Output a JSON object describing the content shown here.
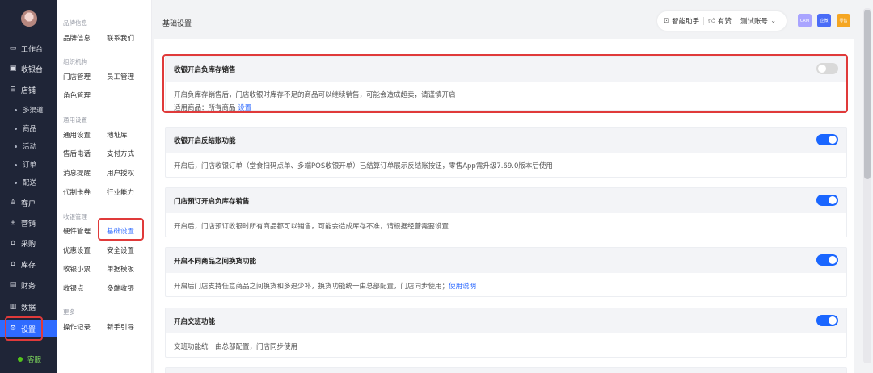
{
  "sidebar": {
    "items": [
      {
        "key": "workbench",
        "label": "工作台",
        "icon": "monitor-icon"
      },
      {
        "key": "pos",
        "label": "收银台",
        "icon": "cashier-icon"
      },
      {
        "key": "store",
        "label": "店铺",
        "icon": "store-icon"
      },
      {
        "key": "customer",
        "label": "客户",
        "icon": "user-icon"
      },
      {
        "key": "marketing",
        "label": "营销",
        "icon": "gift-icon"
      },
      {
        "key": "purchase",
        "label": "采购",
        "icon": "purchase-icon"
      },
      {
        "key": "inventory",
        "label": "库存",
        "icon": "inventory-icon"
      },
      {
        "key": "finance",
        "label": "财务",
        "icon": "finance-icon"
      },
      {
        "key": "data",
        "label": "数据",
        "icon": "bar-chart-icon"
      },
      {
        "key": "settings",
        "label": "设置",
        "icon": "settings-icon"
      }
    ],
    "store_subitems": [
      "多渠道",
      "商品",
      "活动",
      "订单",
      "配送"
    ],
    "support_label": "客服"
  },
  "submenu": {
    "groups": [
      {
        "title": "品牌信息",
        "links": [
          "品牌信息",
          "联系我们"
        ]
      },
      {
        "title": "组织机构",
        "links": [
          "门店管理",
          "员工管理",
          "角色管理"
        ]
      },
      {
        "title": "通用设置",
        "links": [
          "通用设置",
          "地址库",
          "售后电话",
          "支付方式",
          "消息提醒",
          "用户授权",
          "代制卡券",
          "行业能力"
        ]
      },
      {
        "title": "收银管理",
        "links": [
          "硬件管理",
          "基础设置",
          "优惠设置",
          "安全设置",
          "收银小票",
          "单据模板",
          "收银点",
          "多端收银"
        ]
      },
      {
        "title": "更多",
        "links": [
          "操作记录",
          "新手引导"
        ]
      }
    ],
    "active": "基础设置"
  },
  "header": {
    "title": "基础设置",
    "assistant_label": "智能助手",
    "like_label": "有赞",
    "account_label": "测试账号",
    "app_badges": [
      "CRM",
      "企微",
      "零售"
    ],
    "app_badge_colors": [
      "#a9a4ff",
      "#4a6cf7",
      "#f5a623"
    ]
  },
  "settings": [
    {
      "title": "收银开启负库存销售",
      "enabled": false,
      "desc": "开启负库存销售后，门店收银时库存不足的商品可以继续销售，可能会造成超卖，请谨慎开启",
      "extra_prefix": "适用商品：所有商品",
      "extra_link": "设置"
    },
    {
      "title": "收银开启反结账功能",
      "enabled": true,
      "desc": "开启后，门店收银订单（堂食扫码点单、多端POS收银开单）已结算订单展示反结账按钮，零售App需升级7.69.0版本后使用"
    },
    {
      "title": "门店预订开启负库存销售",
      "enabled": true,
      "desc": "开启后，门店预订收银时所有商品都可以销售，可能会造成库存不准，请根据经营需要设置"
    },
    {
      "title": "开启不同商品之间换货功能",
      "enabled": true,
      "desc": "开启后门店支持任意商品之间换货和多退少补，换货功能统一由总部配置，门店同步使用；",
      "desc_link": "使用说明"
    },
    {
      "title": "开启交班功能",
      "enabled": true,
      "desc": "交班功能统一由总部配置，门店同步使用"
    }
  ],
  "colors": {
    "accent": "#2f6bff",
    "sidebar_bg": "#1f2537",
    "highlight": "#e03a3a"
  }
}
